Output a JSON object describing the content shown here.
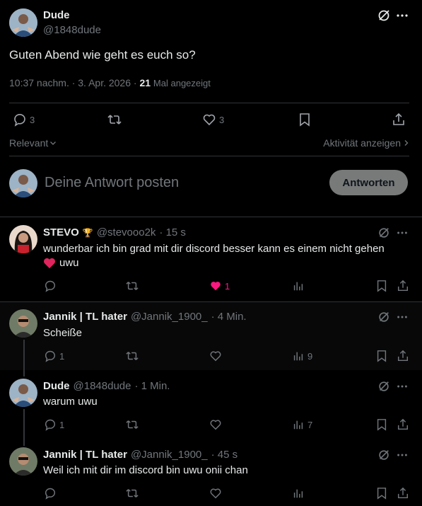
{
  "main_tweet": {
    "name": "Dude",
    "handle": "@1848dude",
    "text": "Guten Abend wie geht es euch so?",
    "time": "10:37 nachm. · 3. Apr. 2026 · ",
    "views_count": "21",
    "views_label": "Mal angezeigt",
    "reply_count": "3",
    "like_count": "3"
  },
  "filters": {
    "sort_label": "Relevant",
    "activity_label": "Aktivität anzeigen"
  },
  "composer": {
    "placeholder": "Deine Antwort posten",
    "button_label": "Antworten"
  },
  "replies": [
    {
      "name": "STEVO",
      "badge": "🏆",
      "handle": "@stevooo2k",
      "time": "· 15 s",
      "text_line1": "wunderbar ich bin grad mit dir discord besser kann es einem nicht gehen",
      "text_line2": "uwu",
      "reply_count": "",
      "like_count": "1",
      "views": ""
    },
    {
      "name": "Jannik | TL hater",
      "handle": "@Jannik_1900_",
      "time": "· 4 Min.",
      "text": "Scheiße",
      "reply_count": "1",
      "views": "9"
    },
    {
      "name": "Dude",
      "handle": "@1848dude",
      "time": "· 1 Min.",
      "text": "warum uwu",
      "reply_count": "1",
      "views": "7"
    },
    {
      "name": "Jannik | TL hater",
      "handle": "@Jannik_1900_",
      "time": "· 45 s",
      "text": "Weil ich mit dir im discord bin uwu onii chan"
    }
  ],
  "colors": {
    "background": "#000000",
    "text": "#e7e9ea",
    "muted": "#71767b",
    "like_active": "#f91880",
    "divider": "#2f3336",
    "button_bg": "#787a7a"
  }
}
